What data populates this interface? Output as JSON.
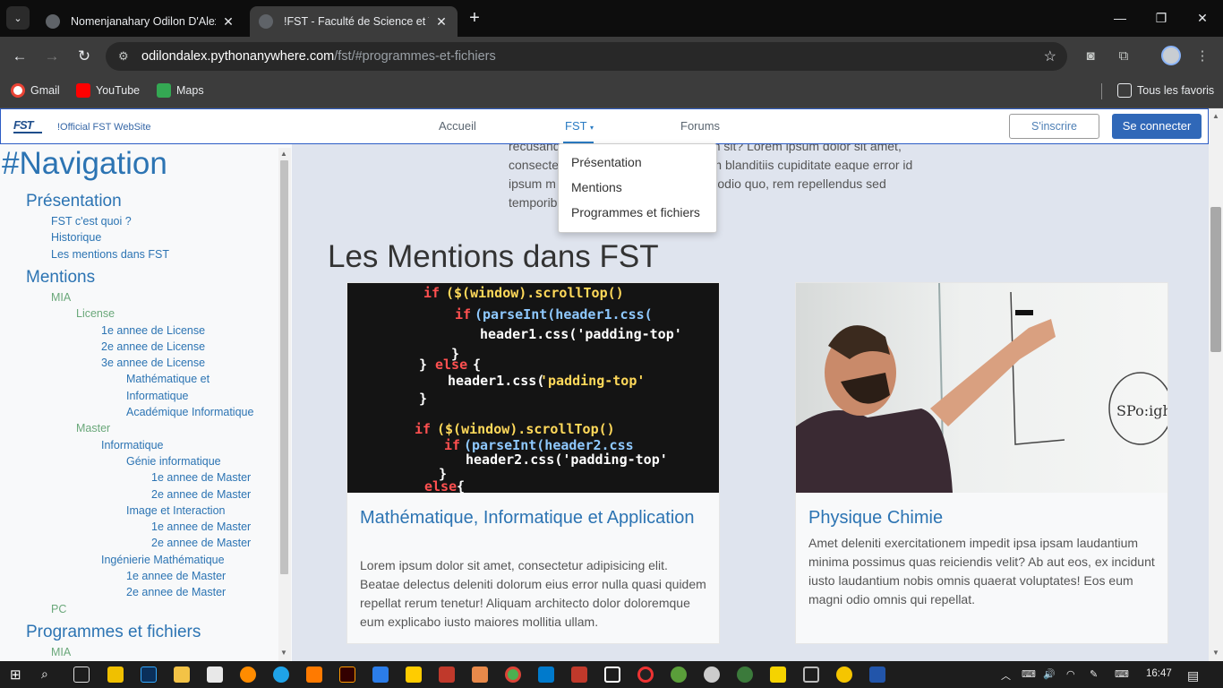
{
  "browser": {
    "tabs": [
      {
        "title": "Nomenjanahary Odilon D'Alex"
      },
      {
        "title": "!FST - Faculté de Science et Tec"
      }
    ],
    "url_host": "odilondalex.pythonanywhere.com",
    "url_path": "/fst/#programmes-et-fichiers",
    "bookmarks": [
      "Gmail",
      "YouTube",
      "Maps"
    ],
    "all_bookmarks": "Tous les favoris"
  },
  "site": {
    "brand": "!Official FST WebSite",
    "nav": {
      "home": "Accueil",
      "fst": "FST",
      "forums": "Forums"
    },
    "signup": "S'inscrire",
    "login": "Se connecter",
    "dropdown": [
      "Présentation",
      "Mentions",
      "Programmes et fichiers"
    ]
  },
  "sidebar": {
    "title": "#Navigation",
    "items": [
      {
        "text": "Présentation",
        "level": 1
      },
      {
        "text": "FST c'est quoi ?",
        "level": 2
      },
      {
        "text": "Historique",
        "level": 2
      },
      {
        "text": "Les mentions dans FST",
        "level": 2
      },
      {
        "text": "Mentions",
        "level": 1
      },
      {
        "text": "MIA",
        "level": 2,
        "accent": true
      },
      {
        "text": "License",
        "level": 3,
        "accent": true
      },
      {
        "text": "1e annee de License",
        "level": 4
      },
      {
        "text": "2e annee de License",
        "level": 4
      },
      {
        "text": "3e annee de License",
        "level": 4
      },
      {
        "text": "Mathématique et",
        "level": 5
      },
      {
        "text": "Informatique",
        "level": 5
      },
      {
        "text": "Académique Informatique",
        "level": 5
      },
      {
        "text": "Master",
        "level": 3,
        "accent": true
      },
      {
        "text": "Informatique",
        "level": 4
      },
      {
        "text": "Génie informatique",
        "level": 5
      },
      {
        "text": "1e annee de Master",
        "level": 6
      },
      {
        "text": "2e annee de Master",
        "level": 6
      },
      {
        "text": "Image et Interaction",
        "level": 5
      },
      {
        "text": "1e annee de Master",
        "level": 6
      },
      {
        "text": "2e annee de Master",
        "level": 6
      },
      {
        "text": "Ingénierie Mathématique",
        "level": 4
      },
      {
        "text": "1e annee de Master",
        "level": 5
      },
      {
        "text": "2e annee de Master",
        "level": 5
      },
      {
        "text": "PC",
        "level": 2,
        "accent": true
      },
      {
        "text": "Programmes et fichiers",
        "level": 1
      },
      {
        "text": "MIA",
        "level": 2,
        "accent": true
      }
    ]
  },
  "main": {
    "intro": "... recusandae ... placeat rerum sit? Lorem ipsum dolor sit amet, consectetur ... ntium aperiam blanditiis cupiditate eaque error id ipsum ... nihil nostrum odio quo, rem repellendus sed temporibus ... tes!",
    "intro_lines": [
      "recusand                        placeat rerum sit? Lorem ipsum dolor sit amet,",
      "consecte                        ntium aperiam blanditiis cupiditate eaque error id",
      "ipsum m                         nihil nostrum odio quo, rem repellendus sed",
      "temporib                        tes!"
    ],
    "heading": "Les Mentions dans FST",
    "cards": [
      {
        "title": "Mathématique, Informatique et Application",
        "text": "Lorem ipsum dolor sit amet, consectetur adipisicing elit. Beatae delectus deleniti dolorum eius error nulla quasi quidem repellat rerum tenetur! Aliquam architecto dolor doloremque eum explicabo iusto maiores mollitia ullam."
      },
      {
        "title": "Physique Chimie",
        "text": "Amet deleniti exercitationem impedit ipsa ipsam laudantium minima possimus quas reiciendis velit? Ab aut eos, ex incidunt iusto laudantium nobis omnis quaerat voluptates! Eos eum magni odio omnis qui repellat."
      }
    ]
  },
  "taskbar": {
    "time": "16:47"
  },
  "colors": {
    "accent_blue": "#2c74b3",
    "accent_green": "#6aa87a",
    "nav_border": "#2c5cc5"
  }
}
